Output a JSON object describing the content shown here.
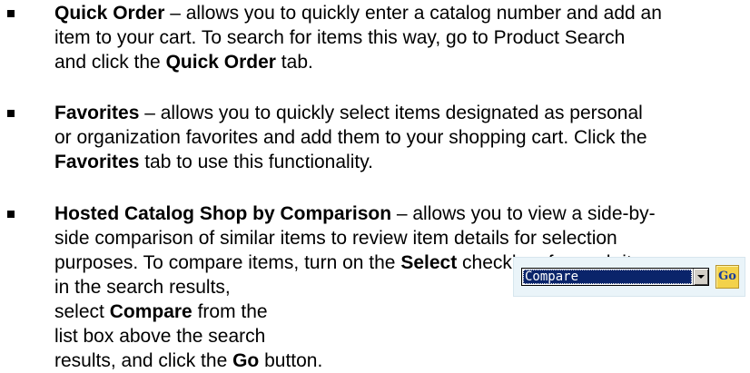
{
  "items": [
    {
      "lines": [
        [
          {
            "t": "Quick Order",
            "b": true
          },
          {
            "t": " – allows you to quickly enter a catalog number and add an",
            "b": false
          }
        ],
        [
          {
            "t": "item to your cart. To search for items this way, go to Product Search",
            "b": false
          }
        ],
        [
          {
            "t": "and click the ",
            "b": false
          },
          {
            "t": "Quick Order",
            "b": true
          },
          {
            "t": " tab.",
            "b": false
          }
        ]
      ]
    },
    {
      "lines": [
        [
          {
            "t": "Favorites",
            "b": true
          },
          {
            "t": " – allows you to quickly select items designated as personal",
            "b": false
          }
        ],
        [
          {
            "t": "or organization favorites and add them to your shopping cart. Click the",
            "b": false
          }
        ],
        [
          {
            "t": "Favorites",
            "b": true
          },
          {
            "t": " tab to use this functionality.",
            "b": false
          }
        ]
      ]
    },
    {
      "lines": [
        [
          {
            "t": "Hosted Catalog Shop by Comparison",
            "b": true
          },
          {
            "t": " – allows you to view a side-by-",
            "b": false
          }
        ],
        [
          {
            "t": "side comparison of similar items to review item details for selection",
            "b": false
          }
        ],
        [
          {
            "t": "purposes. To compare items, turn on the ",
            "b": false
          },
          {
            "t": "Select",
            "b": true
          },
          {
            "t": " checkbox for each item",
            "b": false
          }
        ],
        [
          {
            "t": "in the search results,",
            "b": false
          }
        ],
        [
          {
            "t": "select ",
            "b": false
          },
          {
            "t": "Compare",
            "b": true
          },
          {
            "t": " from the",
            "b": false
          }
        ],
        [
          {
            "t": "list box above the search",
            "b": false
          }
        ],
        [
          {
            "t": "results, and click the ",
            "b": false
          },
          {
            "t": "Go",
            "b": true
          },
          {
            "t": " button.",
            "b": false
          }
        ]
      ]
    }
  ],
  "compare_control": {
    "selected_option": "Compare",
    "go_label": "Go"
  }
}
